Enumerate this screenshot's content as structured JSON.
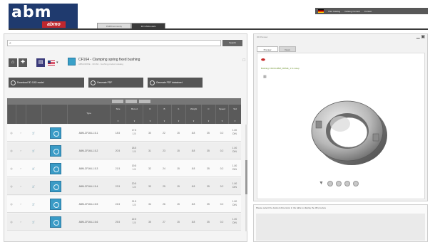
{
  "brand": {
    "logo_text": "abm",
    "logo_sub": "abmo"
  },
  "topbar": {
    "items": [
      "USA Catalog",
      "Catalog Content",
      "Contact"
    ]
  },
  "header_tabs": [
    "PARTcommunity",
    "3D CADmodels"
  ],
  "search": {
    "placeholder": "",
    "value": "",
    "button_label": "Search"
  },
  "product": {
    "title": "CF164 - Clamping spring fixed bushing",
    "subtitle": "ABM-DRIVE  ·  CF164  ·  bushing product catalog"
  },
  "actions": [
    "Download 3D CAD model",
    "Generate PDF",
    "Generate PDF datasheet"
  ],
  "table": {
    "headers": [
      "",
      "",
      "",
      "",
      "Type",
      "Size",
      "Bore d",
      "D",
      "B",
      "b",
      "Weight",
      "C",
      "Speed",
      "Fits",
      "Std"
    ],
    "rows": [
      {
        "id": "ABM-CF164-1.5-1",
        "v1": "18.5",
        "v2a": "17.5",
        "v2b": "1.5",
        "v3": "30",
        "v4": "22",
        "v5": "15",
        "v6": "8.8",
        "v7": "35",
        "v8": "0.2",
        "v9a": "1.00",
        "v9b": "DIN"
      },
      {
        "id": "ABM-CF164-1.5-2",
        "v1": "20.5",
        "v2a": "18.5",
        "v2b": "1.5",
        "v3": "31",
        "v4": "23",
        "v5": "15",
        "v6": "8.8",
        "v7": "35",
        "v8": "0.2",
        "v9a": "1.00",
        "v9b": "DIN"
      },
      {
        "id": "ABM-CF164-1.5-3",
        "v1": "21.5",
        "v2a": "19.5",
        "v2b": "1.5",
        "v3": "32",
        "v4": "24",
        "v5": "15",
        "v6": "8.8",
        "v7": "35",
        "v8": "0.2",
        "v9a": "1.00",
        "v9b": "DIN"
      },
      {
        "id": "ABM-CF164-1.5-4",
        "v1": "22.5",
        "v2a": "20.5",
        "v2b": "1.5",
        "v3": "33",
        "v4": "25",
        "v5": "15",
        "v6": "8.8",
        "v7": "35",
        "v8": "0.2",
        "v9a": "1.00",
        "v9b": "DIN"
      },
      {
        "id": "ABM-CF164-1.5-5",
        "v1": "24.5",
        "v2a": "21.5",
        "v2b": "1.5",
        "v3": "34",
        "v4": "26",
        "v5": "15",
        "v6": "8.8",
        "v7": "35",
        "v8": "0.2",
        "v9a": "1.00",
        "v9b": "DIN"
      },
      {
        "id": "ABM-CF164-1.5-6",
        "v1": "25.5",
        "v2a": "22.5",
        "v2b": "1.5",
        "v3": "35",
        "v4": "27",
        "v5": "15",
        "v6": "8.8",
        "v7": "35",
        "v8": "0.2",
        "v9a": "1.00",
        "v9b": "DIN"
      }
    ]
  },
  "right_panel": {
    "title": "3D Preview",
    "tabs": [
      "Preview",
      "Views"
    ],
    "file_label": "Bushing CF164 ABM_DRIVE_1.5-1.step"
  },
  "bottom_panel": {
    "text": "Please select the desired dimension in the table to display the 3D preview"
  },
  "colors": {
    "header_dark": "#3a3a3a",
    "brand_blue": "#1f3a6e",
    "brand_red": "#c0272d",
    "accent_green": "#6a8f2a",
    "button_gray": "#555555"
  }
}
